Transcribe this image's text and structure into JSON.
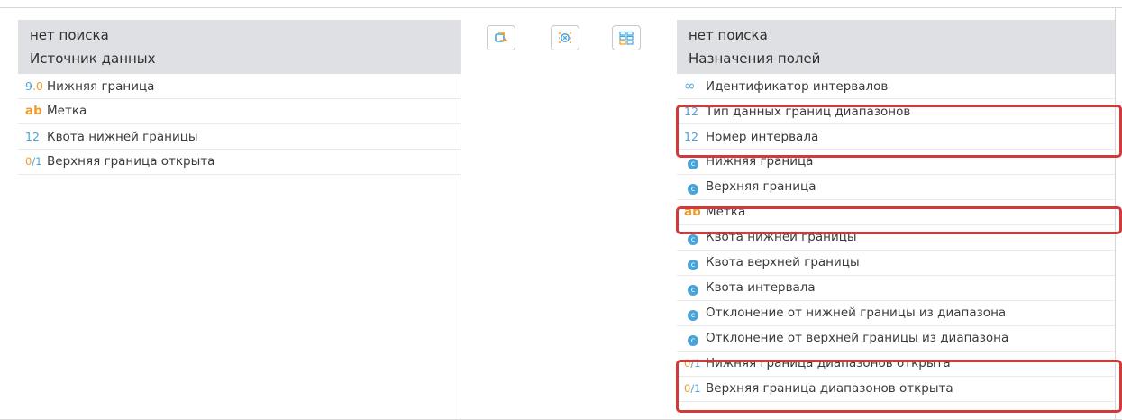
{
  "left_panel": {
    "search": "нет поиска",
    "title": "Источник данных",
    "fields": [
      {
        "type_icon": "float-icon",
        "label": "Нижняя граница"
      },
      {
        "type_icon": "string-icon",
        "label": "Метка"
      },
      {
        "type_icon": "integer-icon",
        "label": "Квота нижней границы"
      },
      {
        "type_icon": "boolean-icon",
        "label": "Верхняя граница открыта"
      }
    ]
  },
  "toolbar": {
    "buttons": [
      {
        "icon": "auto-map-icon"
      },
      {
        "icon": "clear-mapping-icon"
      },
      {
        "icon": "layout-grid-icon"
      }
    ]
  },
  "right_panel": {
    "search": "нет поиска",
    "title": "Назначения полей",
    "fields": [
      {
        "type_icon": "infinity-icon",
        "label": "Идентификатор интервалов"
      },
      {
        "type_icon": "integer-icon",
        "label": "Тип данных границ диапазонов"
      },
      {
        "type_icon": "integer-icon",
        "label": "Номер интервала"
      },
      {
        "type_icon": "calculated-icon",
        "label": "Нижняя граница"
      },
      {
        "type_icon": "calculated-icon",
        "label": "Верхняя граница"
      },
      {
        "type_icon": "string-icon",
        "label": "Метка"
      },
      {
        "type_icon": "calculated-icon",
        "label": "Квота нижней границы"
      },
      {
        "type_icon": "calculated-icon",
        "label": "Квота верхней границы"
      },
      {
        "type_icon": "calculated-icon",
        "label": "Квота интервала"
      },
      {
        "type_icon": "calculated-icon",
        "label": "Отклонение от нижней границы из диапазона"
      },
      {
        "type_icon": "calculated-icon",
        "label": "Отклонение от верхней границы из диапазона"
      },
      {
        "type_icon": "boolean-icon",
        "label": "Нижняя граница диапазонов открыта"
      },
      {
        "type_icon": "boolean-icon",
        "label": "Верхняя граница диапазонов открыта"
      }
    ]
  },
  "icons": {
    "float": {
      "int_part": "9",
      "frac_part": ".0"
    },
    "string": "ab",
    "integer": "12",
    "boolean": {
      "a": "0",
      "b": "/1"
    },
    "infinity": "∞",
    "calculated": "c"
  },
  "colors": {
    "header_bg": "#dfe0e3",
    "icon_blue": "#4aa3d8",
    "icon_orange": "#f09a2d",
    "highlight_red": "#d23a3a"
  }
}
